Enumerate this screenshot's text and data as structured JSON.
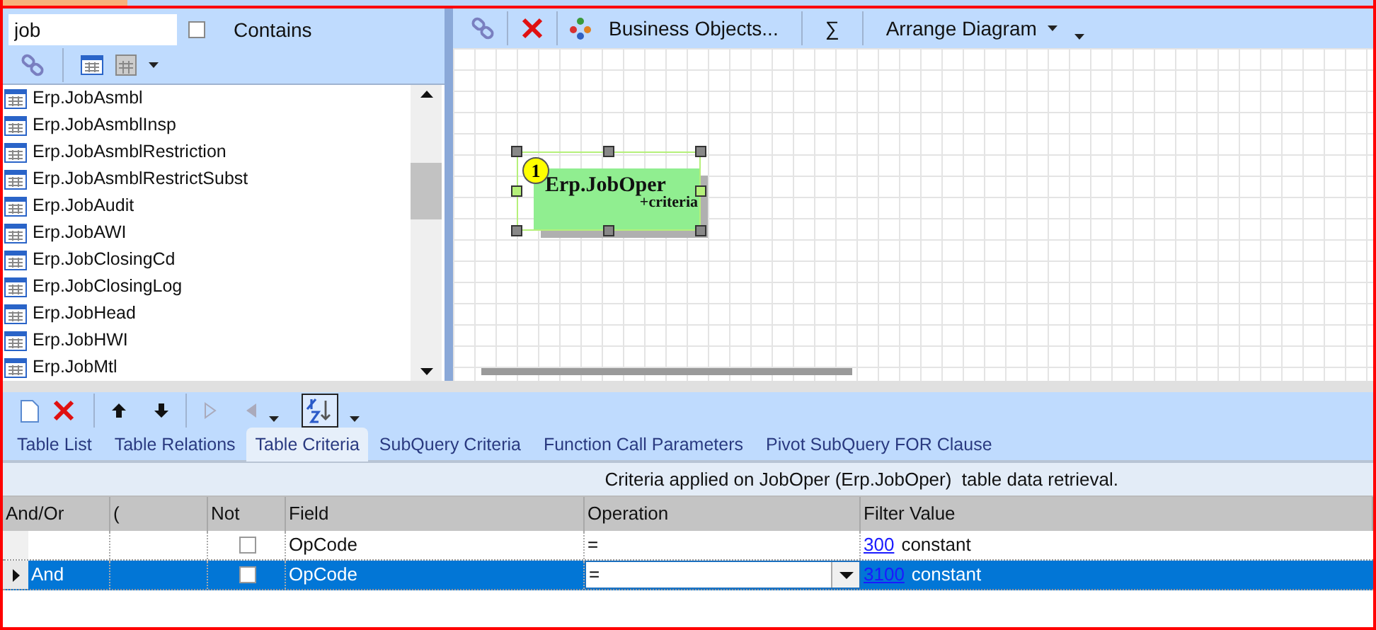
{
  "search": {
    "value": "job",
    "contains_label": "Contains",
    "contains_checked": false
  },
  "tables": [
    {
      "name": "Erp.JobAsmbl"
    },
    {
      "name": "Erp.JobAsmblInsp"
    },
    {
      "name": "Erp.JobAsmblRestriction"
    },
    {
      "name": "Erp.JobAsmblRestrictSubst"
    },
    {
      "name": "Erp.JobAudit"
    },
    {
      "name": "Erp.JobAWI"
    },
    {
      "name": "Erp.JobClosingCd"
    },
    {
      "name": "Erp.JobClosingLog"
    },
    {
      "name": "Erp.JobHead"
    },
    {
      "name": "Erp.JobHWI"
    },
    {
      "name": "Erp.JobMtl"
    }
  ],
  "diagram_toolbar": {
    "business_objects": "Business Objects...",
    "sum": "∑",
    "arrange": "Arrange Diagram"
  },
  "node": {
    "badge": "1",
    "title": "Erp.JobOper",
    "subtitle": "+criteria",
    "selected": true
  },
  "tabs": [
    {
      "label": "Table List",
      "selected": false
    },
    {
      "label": "Table Relations",
      "selected": false
    },
    {
      "label": "Table Criteria",
      "selected": true
    },
    {
      "label": "SubQuery Criteria",
      "selected": false
    },
    {
      "label": "Function Call Parameters",
      "selected": false
    },
    {
      "label": "Pivot SubQuery FOR Clause",
      "selected": false
    }
  ],
  "info": "Criteria applied on JobOper (Erp.JobOper)  table data retrieval.",
  "table": {
    "columns": [
      "And/Or",
      "(",
      "Not",
      "Field",
      "Operation",
      "Filter Value"
    ],
    "rows": [
      {
        "selected": false,
        "and_or": "",
        "not_checked": false,
        "field": "OpCode",
        "operation": "=",
        "filter_link": "300",
        "filter_text": "constant"
      },
      {
        "selected": true,
        "and_or": "And",
        "not_checked": false,
        "field": "OpCode",
        "operation": "=",
        "filter_link": "3100",
        "filter_text": "constant"
      }
    ]
  }
}
